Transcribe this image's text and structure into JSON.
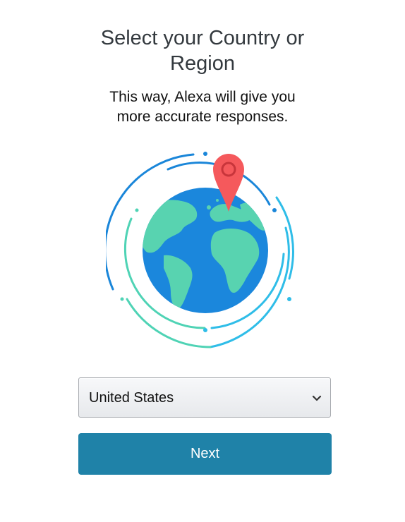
{
  "header": {
    "title_line1": "Select your Country or",
    "title_line2": "Region",
    "subtitle_line1": "This way, Alexa will give you",
    "subtitle_line2": "more accurate responses."
  },
  "illustration": {
    "icon": "globe-with-location-pin",
    "colors": {
      "ocean": "#1b87dc",
      "land": "#58d3b0",
      "pin": "#f5595c",
      "ring_blue": "#1a86d9",
      "ring_cyan": "#2fbde8",
      "ring_teal": "#4fd3b5"
    }
  },
  "country_select": {
    "selected_value": "United States",
    "icon": "chevron-down-icon"
  },
  "actions": {
    "next_label": "Next",
    "button_color": "#1f82a8"
  }
}
